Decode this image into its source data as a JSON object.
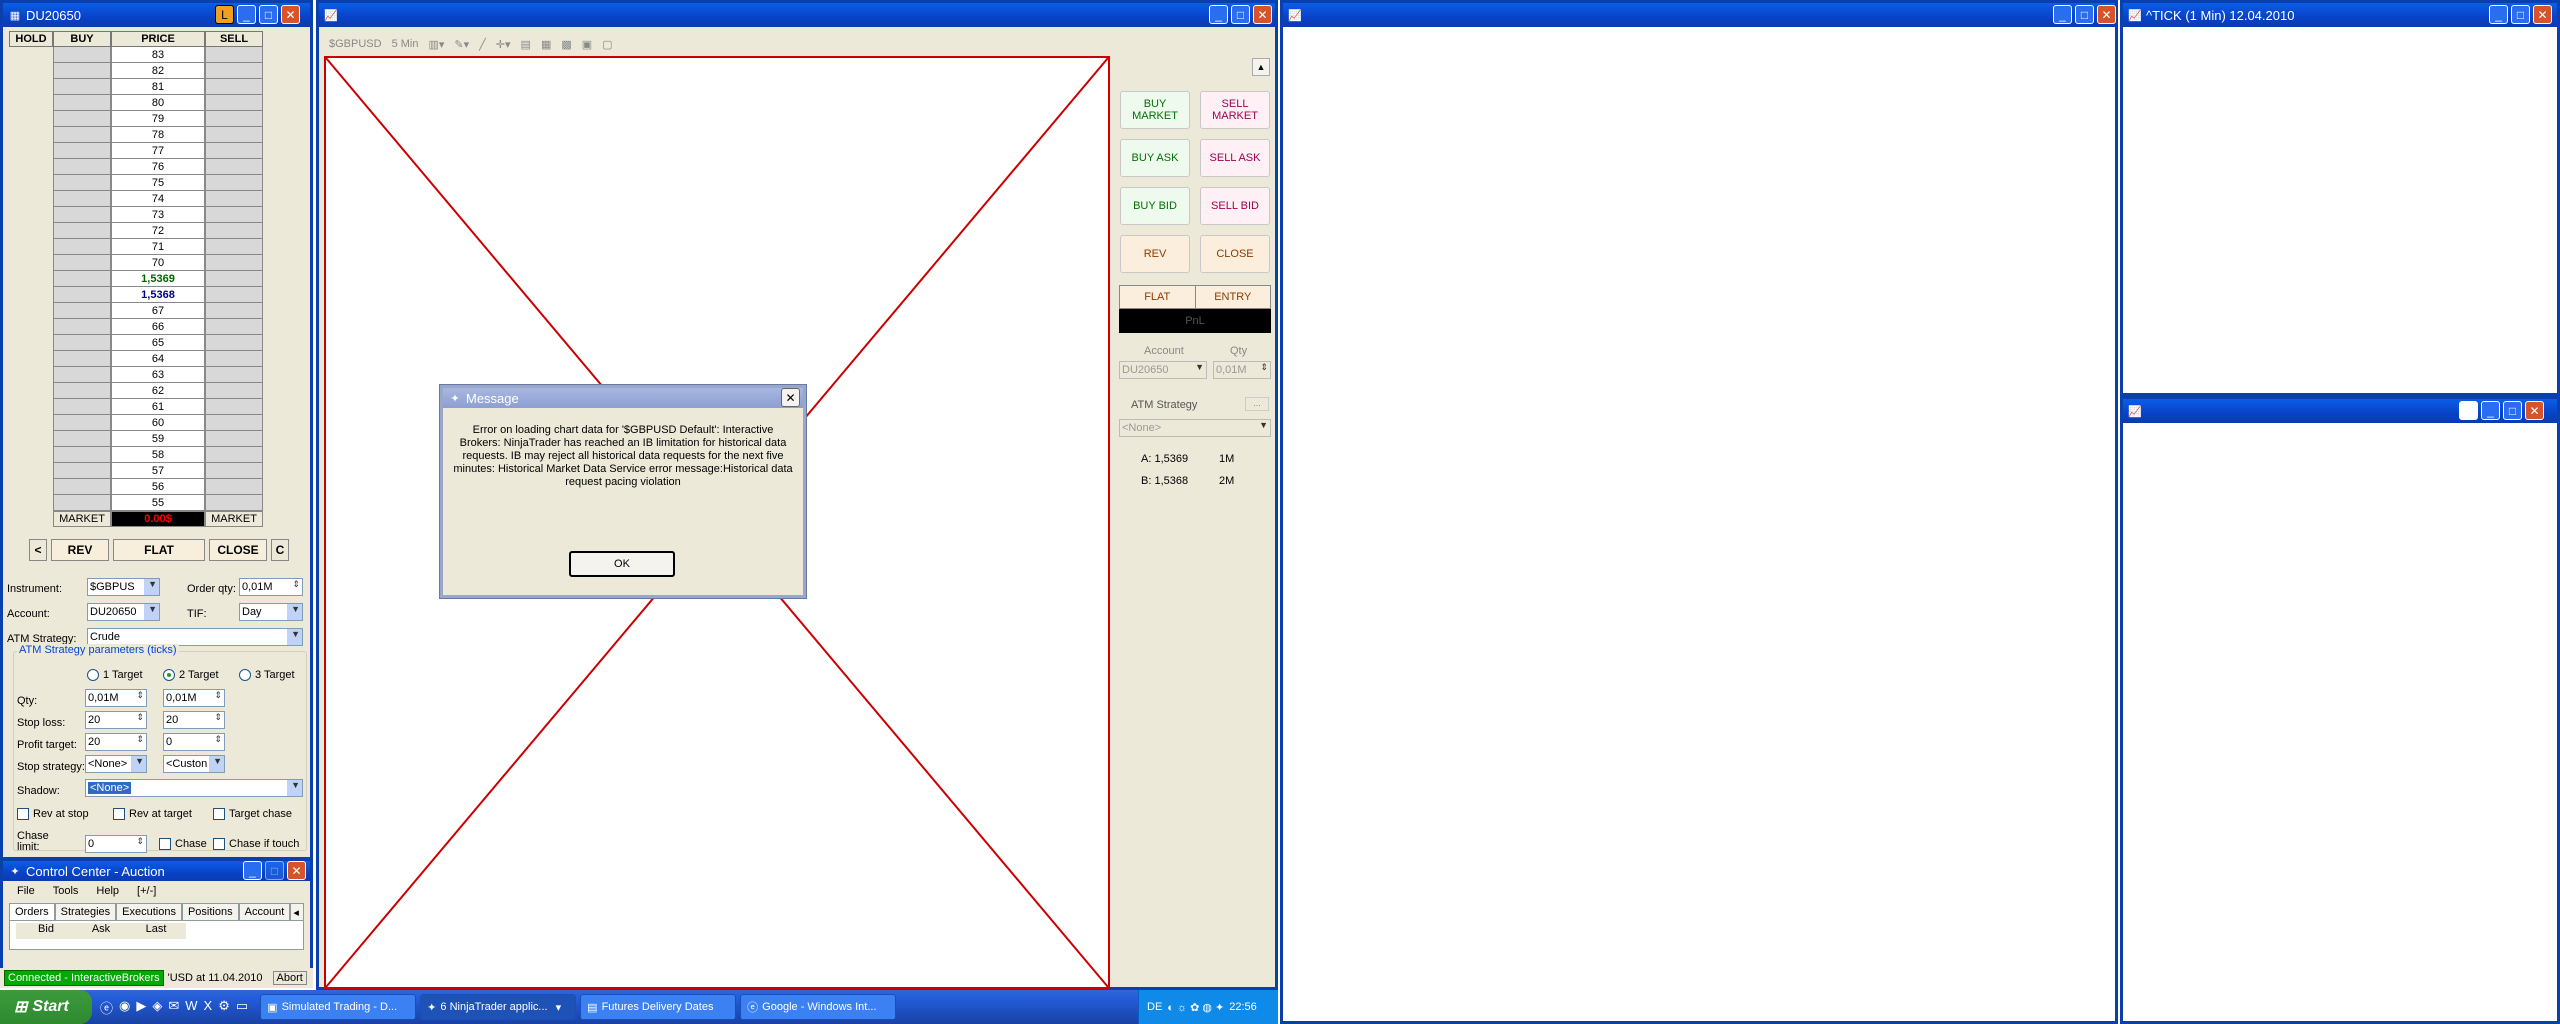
{
  "dom_window": {
    "title": "DU20650",
    "lock_label": "L",
    "headers": {
      "hold": "HOLD",
      "buy": "BUY",
      "price": "PRICE",
      "sell": "SELL"
    },
    "prices": [
      "83",
      "82",
      "81",
      "80",
      "79",
      "78",
      "77",
      "76",
      "75",
      "74",
      "73",
      "72",
      "71",
      "70",
      "1,5369",
      "1,5368",
      "67",
      "66",
      "65",
      "64",
      "63",
      "62",
      "61",
      "60",
      "59",
      "58",
      "57",
      "56",
      "55"
    ],
    "ask_price": "1,5369",
    "bid_price": "1,5368",
    "market_left": "MARKET",
    "pnl_value": "0.00$",
    "market_right": "MARKET",
    "buttons": {
      "prev": "<",
      "rev": "REV",
      "flat": "FLAT",
      "close": "CLOSE",
      "c": "C"
    },
    "form": {
      "instrument_label": "Instrument:",
      "instrument_value": "$GBPUS",
      "order_qty_label": "Order qty:",
      "order_qty_value": "0,01M",
      "account_label": "Account:",
      "account_value": "DU20650",
      "tif_label": "TIF:",
      "tif_value": "Day",
      "atm_label": "ATM Strategy:",
      "atm_value": "Crude",
      "params_label": "ATM Strategy parameters (ticks)",
      "target1": "1 Target",
      "target2": "2 Target",
      "target3": "3 Target",
      "qty_label": "Qty:",
      "qty1": "0,01M",
      "qty2": "0,01M",
      "stop_label": "Stop loss:",
      "stop1": "20",
      "stop2": "20",
      "profit_label": "Profit target:",
      "profit1": "20",
      "profit2": "0",
      "stopstrat_label": "Stop strategy:",
      "stopstrat1": "<None>",
      "stopstrat2": "<Custon",
      "shadow_label": "Shadow:",
      "shadow_value": "<None>",
      "rev_stop": "Rev at stop",
      "rev_target": "Rev at target",
      "target_chase": "Target chase",
      "chase_limit_label": "Chase limit:",
      "chase_limit_value": "0",
      "chase": "Chase",
      "chase_touch": "Chase if touch"
    }
  },
  "control_center": {
    "title": "Control Center - Auction",
    "menu": [
      "File",
      "Tools",
      "Help",
      "[+/-]"
    ],
    "tabs": [
      "Orders",
      "Strategies",
      "Executions",
      "Positions",
      "Account"
    ],
    "columns": [
      "Bid",
      "Ask",
      "Last"
    ],
    "status_conn": "Connected - InteractiveBrokers",
    "status_msg": "'USD at 11.04.2010",
    "abort": "Abort"
  },
  "chart_window": {
    "toolbar": [
      "$GBPUSD",
      "5 Min"
    ],
    "order_buttons": {
      "buy_market": "BUY MARKET",
      "sell_market": "SELL MARKET",
      "buy_ask": "BUY ASK",
      "sell_ask": "SELL ASK",
      "buy_bid": "BUY BID",
      "sell_bid": "SELL BID",
      "rev": "REV",
      "close": "CLOSE",
      "flat": "FLAT",
      "entry": "ENTRY",
      "pnl": "PnL"
    },
    "account_label": "Account",
    "qty_label": "Qty",
    "account_value": "DU20650",
    "qty_value": "0,01M",
    "atm_label": "ATM Strategy",
    "atm_value": "<None>",
    "ask_line": "A: 1,5369",
    "ask_size": "1M",
    "bid_line": "B: 1,5368",
    "bid_size": "2M"
  },
  "dialog": {
    "title": "Message",
    "text": "Error on loading chart data for '$GBPUSD Default': Interactive Brokers: NinjaTrader has reached an IB limitation for historical data requests. IB may reject all historical data requests for the next five minutes: Historical Market Data Service error message:Historical data request pacing violation",
    "ok": "OK"
  },
  "tick_window": {
    "title": "^TICK (1 Min)  12.04.2010"
  },
  "taskbar": {
    "start": "Start",
    "tasks": [
      "Simulated Trading - D...",
      "6 NinjaTrader applic...",
      "Futures Delivery Dates",
      "Google - Windows Int..."
    ],
    "lang": "DE",
    "clock": "22:56"
  }
}
